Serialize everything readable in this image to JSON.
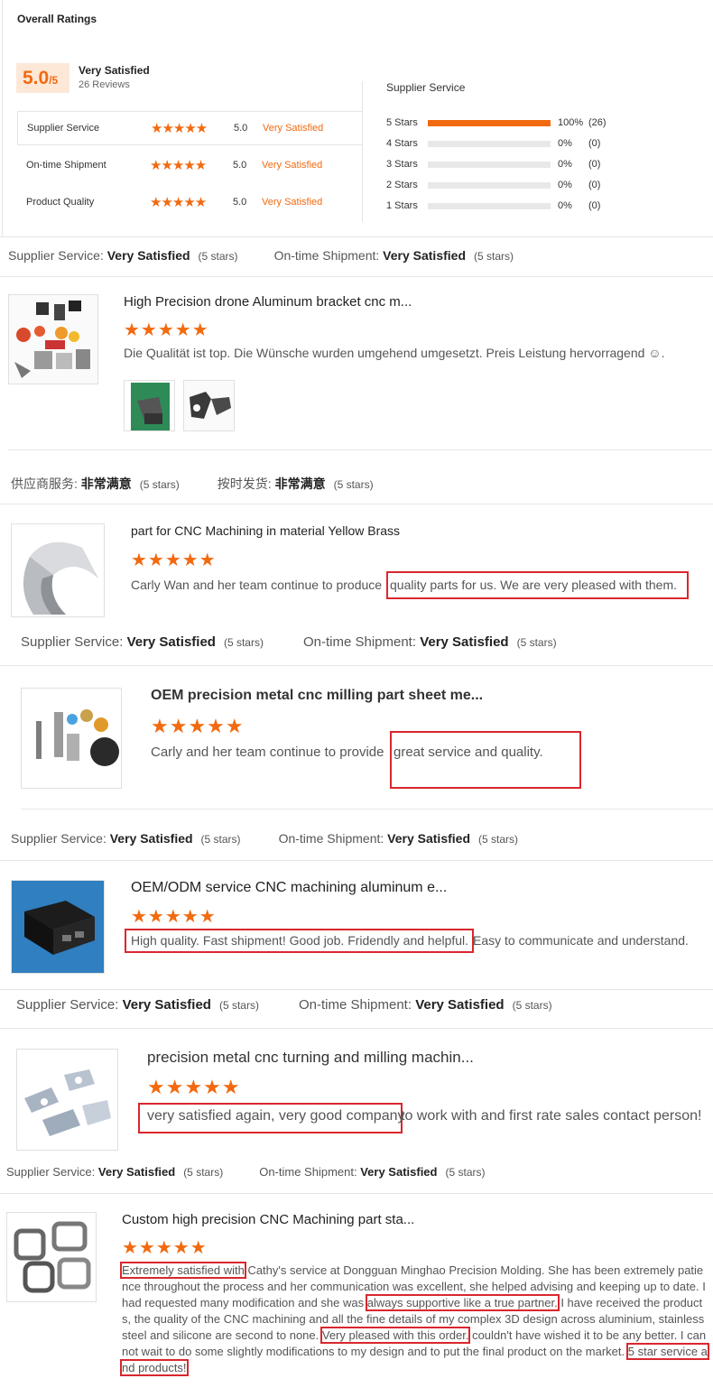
{
  "overall": {
    "title": "Overall Ratings",
    "score": "5.0",
    "score_den": "/5",
    "satisfaction": "Very Satisfied",
    "reviews": "26 Reviews",
    "criteria": [
      {
        "label": "Supplier Service",
        "stars": "★★★★★",
        "value": "5.0",
        "text": "Very Satisfied"
      },
      {
        "label": "On-time Shipment",
        "stars": "★★★★★",
        "value": "5.0",
        "text": "Very Satisfied"
      },
      {
        "label": "Product Quality",
        "stars": "★★★★★",
        "value": "5.0",
        "text": "Very Satisfied"
      }
    ],
    "distribution_title": "Supplier Service",
    "distribution": [
      {
        "label": "5 Stars",
        "fraction": 1.0,
        "pct": "100%",
        "count": "(26)"
      },
      {
        "label": "4 Stars",
        "fraction": 0.0,
        "pct": "0%",
        "count": "(0)"
      },
      {
        "label": "3 Stars",
        "fraction": 0.0,
        "pct": "0%",
        "count": "(0)"
      },
      {
        "label": "2 Stars",
        "fraction": 0.0,
        "pct": "0%",
        "count": "(0)"
      },
      {
        "label": "1 Stars",
        "fraction": 0.0,
        "pct": "0%",
        "count": "(0)"
      }
    ],
    "accent": "#f26a10"
  },
  "status_labels": {
    "supplier": "Supplier Service:",
    "shipment": "On-time Shipment:",
    "value": "Very Satisfied",
    "stars": "(5 stars)",
    "cn_supplier": "供应商服务:",
    "cn_shipment": "按时发货:",
    "cn_value": "非常满意"
  },
  "reviews": [
    {
      "title": "High Precision drone Aluminum bracket cnc m...",
      "stars": "★★★★★",
      "text": "Die Qualität ist top. Die Wünsche wurden umgehend umgesetzt. Preis Leistung hervorragend ☺."
    },
    {
      "title": "part for CNC Machining in material Yellow Brass",
      "stars": "★★★★★",
      "text_pre": "Carly Wan and her team continue to produce ",
      "text_hl": "quality parts for us. We are very pleased with them."
    },
    {
      "title": "OEM precision metal cnc milling part sheet me...",
      "stars": "★★★★★",
      "text_pre": "Carly and her team continue to provide ",
      "text_hl": "great service and quality."
    },
    {
      "title": "OEM/ODM service CNC machining aluminum e...",
      "stars": "★★★★★",
      "text_hl": "High quality. Fast shipment! Good job. Fridendly and helpful.",
      "text_post": " Easy to communicate and understand."
    },
    {
      "title": "precision metal cnc turning and milling machin...",
      "stars": "★★★★★",
      "text_hl": "very satisfied again,  very good company",
      "text_post": " to work with and first rate sales contact person!"
    },
    {
      "title": "Custom high precision CNC Machining part sta...",
      "stars": "★★★★★",
      "p1": "Extremely satisfied with",
      "p2": " Cathy's service at Dongguan Minghao Precision Molding. She has been extremely patience throughout the process and her communication was excellent, she helped advising and keeping up to date. I had requested many modification and she was ",
      "p3": "always supportive like a true partner.",
      "p4": " I have received the products, the quality of the CNC machining and all the fine details of my complex 3D design across aluminium, stainless steel and silicone are second to none. ",
      "p5": "Very pleased with this order.",
      "p6": "  couldn't have wished it to be any better. I cannot wait to do some slightly modifications to my design and to put the final product on the market. ",
      "p7": "5 star service and products!"
    }
  ]
}
